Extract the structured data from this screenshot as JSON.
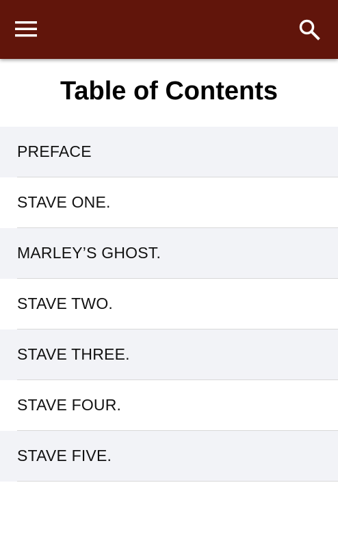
{
  "header": {
    "background_color": "#61150b",
    "menu_icon": "hamburger-menu-icon",
    "search_icon": "search-icon"
  },
  "page": {
    "title": "Table of Contents"
  },
  "toc": {
    "items": [
      {
        "label": "PREFACE"
      },
      {
        "label": "STAVE ONE."
      },
      {
        "label": "MARLEY’S GHOST."
      },
      {
        "label": "STAVE TWO."
      },
      {
        "label": "STAVE THREE."
      },
      {
        "label": "STAVE FOUR."
      },
      {
        "label": "STAVE FIVE."
      }
    ]
  },
  "colors": {
    "row_alt_background": "#f2f3f7",
    "divider": "#d8d8d8"
  }
}
